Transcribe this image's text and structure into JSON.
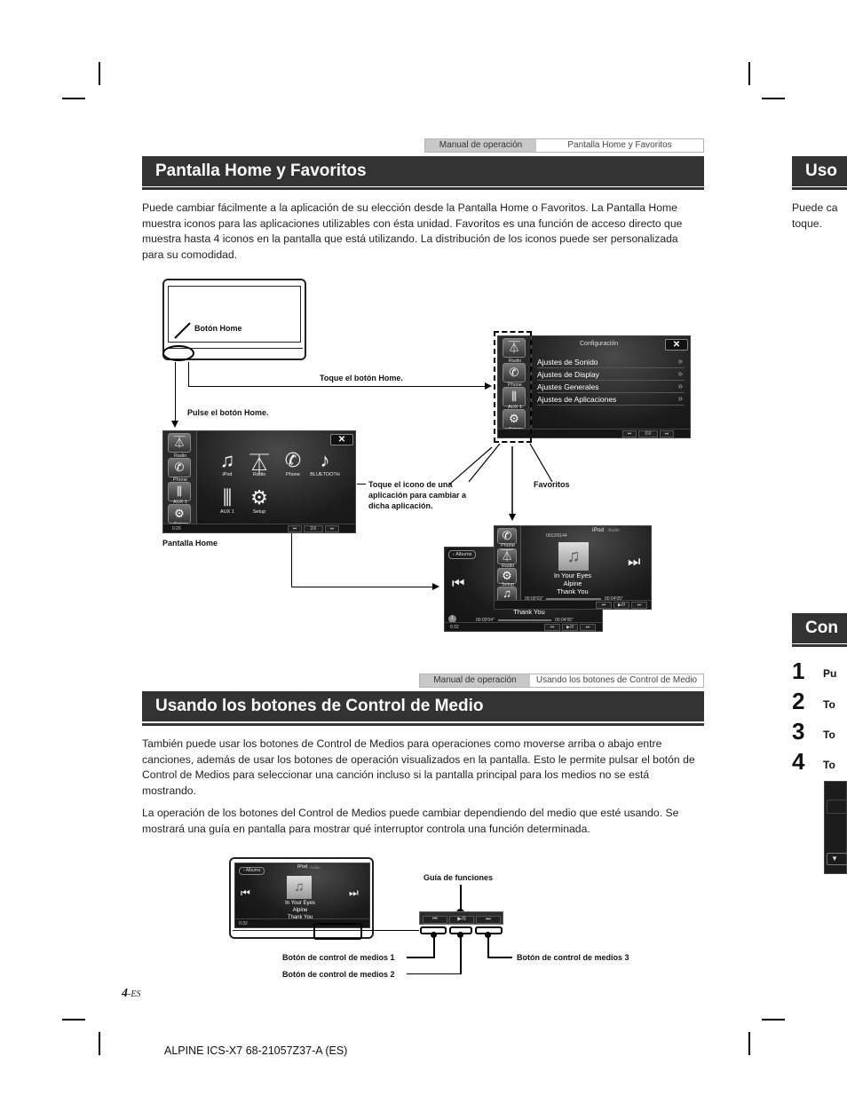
{
  "page": {
    "footer_page_number": "4",
    "footer_page_suffix": "-ES",
    "footer_code": "ALPINE ICS-X7 68-21057Z37-A (ES)"
  },
  "section1": {
    "breadcrumb": [
      "Manual de operación",
      "Pantalla Home y Favoritos"
    ],
    "title": "Pantalla Home y Favoritos",
    "paragraph": "Puede cambiar fácilmente a la aplicación de su elección desde la Pantalla Home o Favoritos. La Pantalla Home muestra iconos para las aplicaciones utilizables con ésta unidad. Favoritos es una función de acceso directo que muestra hasta 4 iconos en la pantalla que está utilizando. La distribución de los iconos puede ser personalizada para su comodidad.",
    "diagram": {
      "label_home_button": "Botón Home",
      "label_touch_home": "Toque el botón Home.",
      "label_press_home": "Pulse el botón Home.",
      "label_touch_icon": "Toque el icono de una aplicación para cambiar a dicha aplicación.",
      "label_favorites": "Favoritos",
      "label_home_screen": "Pantalla Home",
      "config_screen": {
        "title": "Configuración",
        "items": [
          "Ajustes de Sonido",
          "Ajustes de Display",
          "Ajustes Generales",
          "Ajustes de Aplicaciones"
        ],
        "seek_label": "DX SEEK"
      },
      "favorites_bar": [
        "Radio",
        "Phone",
        "AUX 1",
        "Setup"
      ],
      "home_screen": {
        "apps_row1": [
          "iPod",
          "Radio",
          "Phone",
          "BLUETOOTH"
        ],
        "apps_row2": [
          "AUX 1",
          "Setup"
        ],
        "clock": "0:26",
        "seek_label": "DX SEEK"
      },
      "ipod_screen_front": {
        "source": "iPod",
        "sub": "Audio",
        "track_count": "0012/0144",
        "song": "In Your Eyes",
        "artist": "Alpine",
        "album": "Thank You",
        "elapsed": "00:00'03\"",
        "total": "00:04'05\"",
        "favorites": [
          "Phone",
          "Radio",
          "Setup",
          "iPod"
        ]
      },
      "ipod_screen_back": {
        "back_label": "Albums",
        "album": "Thank You",
        "elapsed": "00:00'04\"",
        "total": "00:04'05\"",
        "clock": "0:32"
      }
    }
  },
  "section2": {
    "breadcrumb": [
      "Manual de operación",
      "Usando los botones de Control de Medio"
    ],
    "title": "Usando los botones de Control de Medio",
    "paragraphs": [
      "También puede usar los botones de Control de Medios para operaciones como moverse arriba o abajo entre canciones, además de usar los botones de operación visualizados en la pantalla. Esto le permite pulsar el botón de Control de Medios para seleccionar una canción incluso si la pantalla principal para los medios no se está mostrando.",
      "La operación de los botones del Control de Medios puede cambiar dependiendo del medio que esté usando. Se mostrará una guía en pantalla para mostrar qué interruptor controla una función determinada."
    ],
    "diagram": {
      "label_guide": "Guía de funciones",
      "label_btn1": "Botón de control de medios 1",
      "label_btn2": "Botón de control de medios 2",
      "label_btn3": "Botón de control de medios 3",
      "guide_icons": [
        "⏮",
        "▶/II",
        "⏭"
      ],
      "screen": {
        "back_label": "Albums",
        "source": "iPod",
        "sub": "Audio",
        "song": "In Your Eyes",
        "artist": "Alpine",
        "album": "Thank You",
        "clock": "0:32"
      }
    }
  },
  "right_page": {
    "header1": "Uso",
    "text1_line1": "Puede ca",
    "text1_line2": "toque.",
    "header2": "Con",
    "steps": [
      {
        "num": "1",
        "text": "Pu"
      },
      {
        "num": "2",
        "text": "To"
      },
      {
        "num": "3",
        "text": "To"
      },
      {
        "num": "4",
        "text": "To"
      }
    ]
  }
}
